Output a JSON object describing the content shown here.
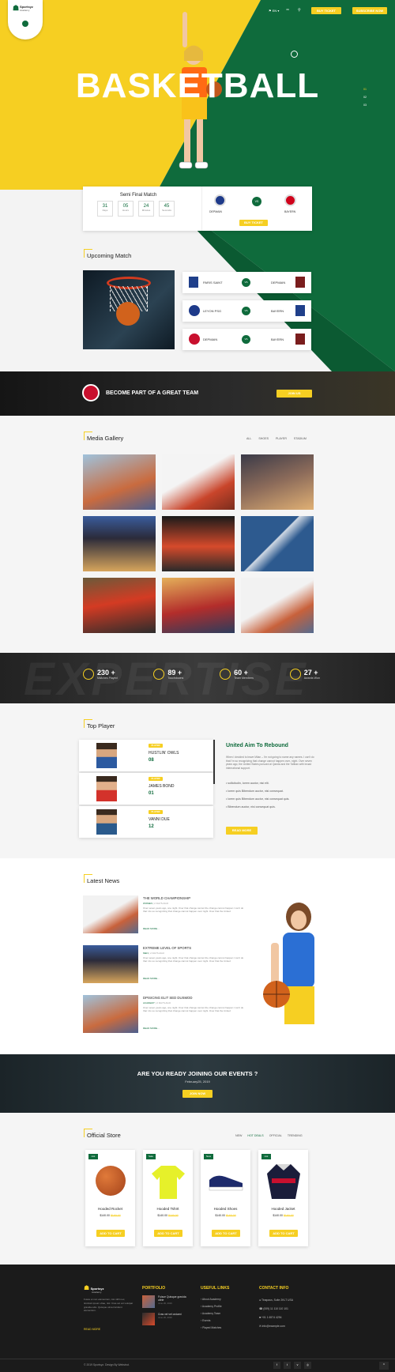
{
  "header": {
    "brand_line1": "Sportsyz",
    "brand_line2": "Academy",
    "lang": "EN",
    "buy_ticket": "BUY TICKET",
    "subscribe": "SUBSCRIBE NOW"
  },
  "hero": {
    "title": "BASKETBALL",
    "pager": [
      "01",
      "02",
      "03"
    ]
  },
  "semi_final": {
    "title": "Semi Final Match",
    "countdown": [
      {
        "value": "31",
        "label": "Days"
      },
      {
        "value": "05",
        "label": "Hours"
      },
      {
        "value": "24",
        "label": "Minutes"
      },
      {
        "value": "45",
        "label": "Seconds"
      }
    ],
    "team_left": "DEPMAIN",
    "vs": "VS",
    "team_right": "BAYERN",
    "buy": "BUY TICKET"
  },
  "upcoming": {
    "title": "Upcoming Match",
    "matches": [
      {
        "left": "PARIS SAINT",
        "vs": "VS",
        "right": "DEPMAIN"
      },
      {
        "left": "LEYON PSG",
        "vs": "VS",
        "right": "BAYERN"
      },
      {
        "left": "DEPMAIN",
        "vs": "VS",
        "right": "BAYERN"
      }
    ]
  },
  "team_banner": {
    "text": "BECOME PART OF A GREAT TEAM",
    "button": "JOIN US"
  },
  "gallery": {
    "title": "Media Gallery",
    "filters": [
      "ALL",
      "SHOES",
      "PLAYER",
      "STADIUM"
    ]
  },
  "stats": {
    "bg_text": "EXPERTISE",
    "items": [
      {
        "value": "230 +",
        "label": "Matches Played"
      },
      {
        "value": "89 +",
        "label": "Touchdowns"
      },
      {
        "value": "60 +",
        "label": "Team Members"
      },
      {
        "value": "27 +",
        "label": "Awards Won"
      }
    ]
  },
  "top_player": {
    "title": "Top Player",
    "players": [
      {
        "tag": "PLAYER",
        "name": "HUSTLIN' OWLS",
        "number": "08"
      },
      {
        "tag": "PLAYER",
        "name": "JAMES BOND",
        "number": "01"
      },
      {
        "tag": "PLAYER",
        "name": "VANNI DUE",
        "number": "12"
      }
    ],
    "aim_title": "United Aim To Rebound",
    "aim_text": "When I decided to leave Milan – I'm not going to name any names. I can't do that I'm so recognizing that change cannot happen over- night. Over seven years ago, the United States pursued al Qaeda and the Taliban with broad international support.",
    "bullets": [
      "sollicitudin, lorem auctor, nisi elit.",
      "lorem quis Bibendum auctor, nisi consequat.",
      "lorem quis Bibendum auctor, nisi consequat quis.",
      "Bibendum auctor, nisi consequat quis."
    ],
    "read_more": "READ MORE"
  },
  "news": {
    "title": "Latest News",
    "items": [
      {
        "title": "THE WORLD CHAMPIONSHIP",
        "meta_cat": "WOMEN",
        "meta_time": "2 DAYS AGO",
        "text": "Over seven years ago, one night. Over that change cannot the change cannot happen I can't do that I do so recognizing that change cannot happen over night. Over that the United",
        "more": "READ MORE..."
      },
      {
        "title": "EXTREME LEVEL OF SPORTS",
        "meta_cat": "MEN",
        "meta_time": "2 DAYS AGO",
        "text": "Over seven years ago, one night. Over that change cannot the change cannot happen I can't do that I do so recognizing that change cannot happen over night. Over that the United",
        "more": "READ MORE..."
      },
      {
        "title": "DPISICING ELIT SED DUSMOD",
        "meta_cat": "ACADEMY",
        "meta_time": "2 DAYS AGO",
        "text": "Over seven years ago, one night. Over that change cannot the change cannot happen I can't do that I do so recognizing that change cannot happen over night. Over that the United",
        "more": "READ MORE..."
      }
    ]
  },
  "events": {
    "title": "ARE YOU READY JOINING OUR EVENTS ?",
    "date": "February25, 2019",
    "button": "JOIN NOW"
  },
  "store": {
    "title": "Official Store",
    "filters": [
      "NEW",
      "HOT DEALS",
      "OFFICIAL",
      "TRENDING"
    ],
    "products": [
      {
        "badge": "Hot",
        "name": "Hooded Rocket",
        "price": "$140.00",
        "old": "$160.00",
        "button": "ADD TO CART"
      },
      {
        "badge": "Sale",
        "name": "Hooded TshIrt",
        "price": "$140.00",
        "old": "$160.00",
        "button": "ADD TO CART"
      },
      {
        "badge": "New",
        "name": "Hooded Shoes",
        "price": "$140.00",
        "old": "$160.00",
        "button": "ADD TO CART"
      },
      {
        "badge": "Hot",
        "name": "Hooded Jacket",
        "price": "$140.00",
        "old": "$160.00",
        "button": "ADD TO CART"
      }
    ]
  },
  "footer": {
    "brand_line1": "Sportsyz",
    "brand_line2": "Academy",
    "about": "Fusce et non elementum, nisi nibh nec, tincidunt ipsum vitae, nisl. Cras vel vel volutpat gravida odio. Quisque ulma tincidunt elementum.",
    "read_more": "READ MORE",
    "portfolio_title": "PORTFOLIO",
    "portfolio": [
      {
        "title": "Fuisce Quisque gravida ultrie",
        "date": "June 26, 2019"
      },
      {
        "title": "Cras vel vel orciami",
        "date": "June 26, 2019"
      }
    ],
    "links_title": "USEFUL LINKS",
    "links": [
      "About Academy",
      "Academy Profile",
      "Academy Team",
      "Events",
      "Played Matches"
    ],
    "contact_title": "CONTACT INFO",
    "contact": [
      "Tinapaus, Suite 2KLT USA",
      "(009) 11 110 110 101",
      "+01 1 6574 4294",
      "info@example.com"
    ],
    "copyright": "© 2019 Sportsyz. Design By Webstrot."
  },
  "colors": {
    "accent": "#f6cf22",
    "brand_green": "#0f6b3c",
    "dark": "#1d1d1d"
  }
}
